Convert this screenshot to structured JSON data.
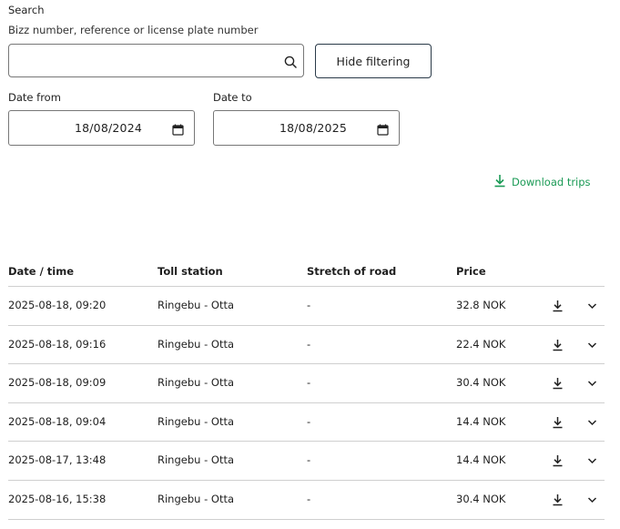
{
  "filters": {
    "search_label": "Search",
    "search_help": "Bizz number, reference or license plate number",
    "search_value": "",
    "hide_filtering_label": "Hide filtering",
    "date_from_label": "Date from",
    "date_from_value": "18/08/2024",
    "date_to_label": "Date to",
    "date_to_value": "18/08/2025"
  },
  "download_trips_label": "Download trips",
  "table": {
    "headers": [
      "Date / time",
      "Toll station",
      "Stretch of road",
      "Price"
    ],
    "rows": [
      {
        "datetime": "2025-08-18, 09:20",
        "station": "Ringebu - Otta",
        "stretch": "-",
        "price": "32.8 NOK"
      },
      {
        "datetime": "2025-08-18, 09:16",
        "station": "Ringebu - Otta",
        "stretch": "-",
        "price": "22.4 NOK"
      },
      {
        "datetime": "2025-08-18, 09:09",
        "station": "Ringebu - Otta",
        "stretch": "-",
        "price": "30.4 NOK"
      },
      {
        "datetime": "2025-08-18, 09:04",
        "station": "Ringebu - Otta",
        "stretch": "-",
        "price": "14.4 NOK"
      },
      {
        "datetime": "2025-08-17, 13:48",
        "station": "Ringebu - Otta",
        "stretch": "-",
        "price": "14.4 NOK"
      },
      {
        "datetime": "2025-08-16, 15:38",
        "station": "Ringebu - Otta",
        "stretch": "-",
        "price": "30.4 NOK"
      }
    ]
  },
  "icons": {
    "search": "search-icon",
    "calendar": "calendar-icon",
    "download": "download-icon",
    "expand": "chevron-down-icon"
  },
  "colors": {
    "accent_green": "#1a9a55",
    "border": "#777777",
    "divider": "#cfcfcf"
  }
}
